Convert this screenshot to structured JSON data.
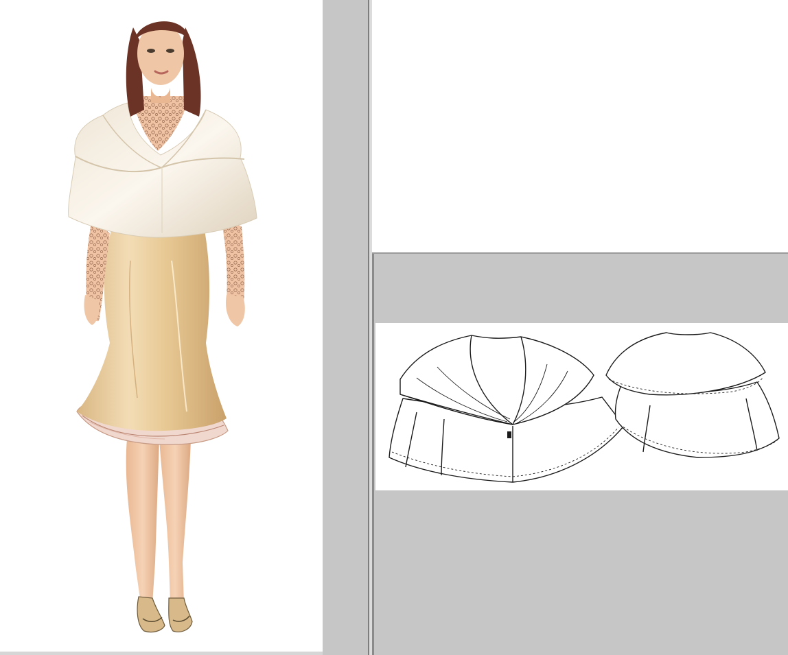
{
  "illustration": {
    "subject": "fashion-figure",
    "colors": {
      "cape": "#f3ece0",
      "cape_shadow": "#d9cdb8",
      "skirt": "#e9cfa3",
      "skirt_shadow": "#c9a56f",
      "ruffle": "#f1d8cf",
      "skin": "#f0c7a6",
      "lace": "#b0846a",
      "hair": "#6b3325",
      "shoes": "#d7b98a"
    }
  },
  "technical_drawing": {
    "views": [
      "front-view",
      "back-view"
    ],
    "line_color": "#1a1a1a",
    "fill_color": "#ffffff"
  },
  "chrome": {
    "panel_gray": "#c6c6c6",
    "divider_dark": "#7d7d7d"
  }
}
